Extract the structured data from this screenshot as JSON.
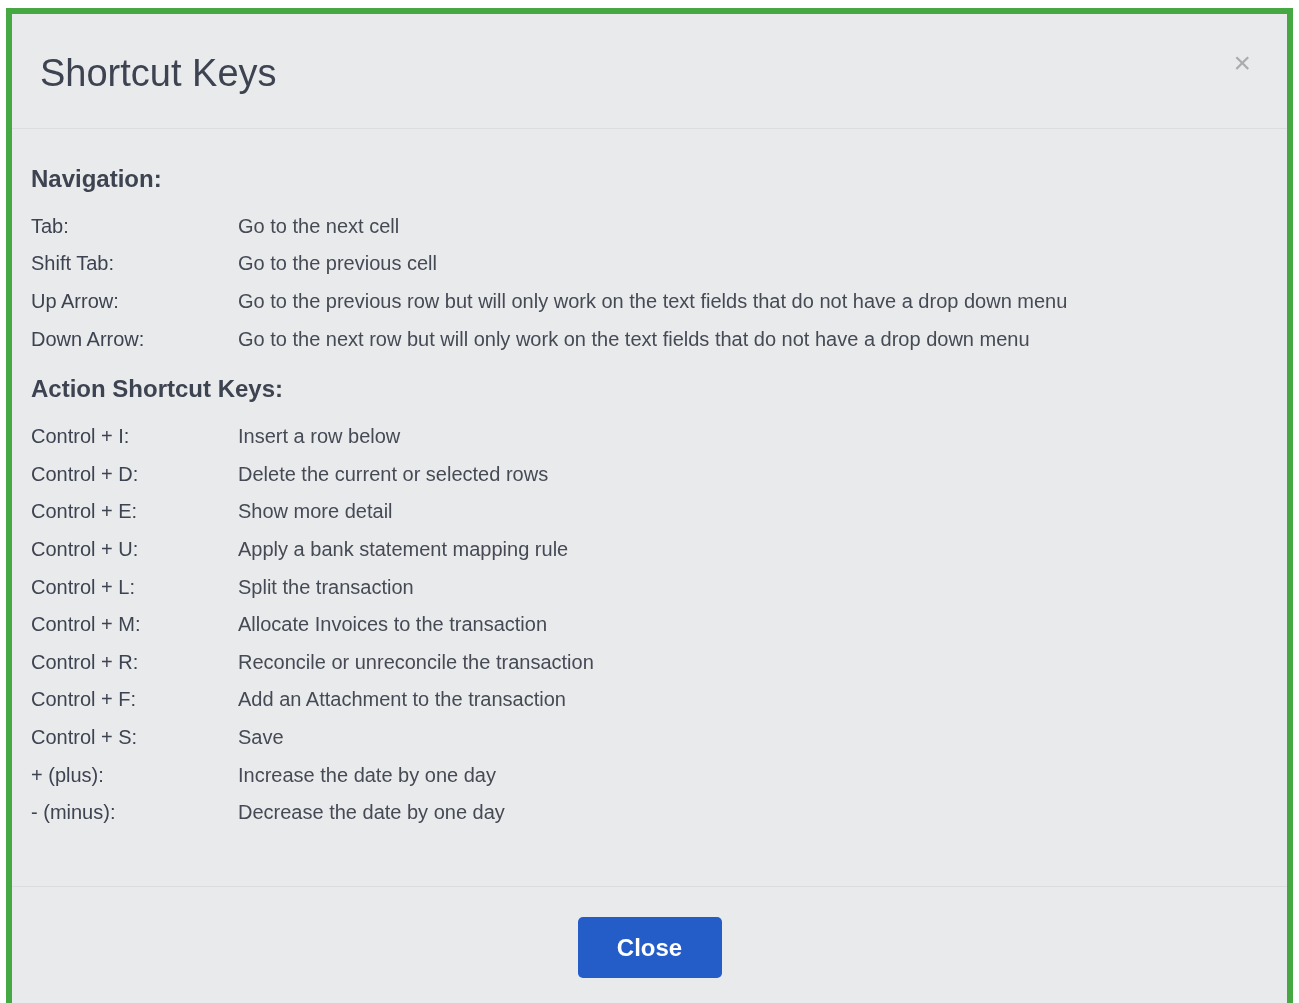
{
  "dialog": {
    "title": "Shortcut Keys",
    "close_icon": "×"
  },
  "sections": [
    {
      "heading": "Navigation:",
      "rows": [
        {
          "key": "Tab:",
          "action": "Go to the next cell"
        },
        {
          "key": "Shift Tab:",
          "action": "Go to the previous cell"
        },
        {
          "key": "Up Arrow:",
          "action": "Go to the previous row but will only work on the text fields that do not have a drop down menu"
        },
        {
          "key": "Down Arrow:",
          "action": "Go to the next row but will only work on the text fields that do not have a drop down menu"
        }
      ]
    },
    {
      "heading": "Action Shortcut Keys:",
      "rows": [
        {
          "key": "Control + I:",
          "action": "Insert a row below"
        },
        {
          "key": "Control + D:",
          "action": "Delete the current or selected rows"
        },
        {
          "key": "Control + E:",
          "action": "Show more detail"
        },
        {
          "key": "Control + U:",
          "action": "Apply a bank statement mapping rule"
        },
        {
          "key": "Control + L:",
          "action": "Split the transaction"
        },
        {
          "key": "Control + M:",
          "action": "Allocate Invoices to the transaction"
        },
        {
          "key": "Control + R:",
          "action": "Reconcile or unreconcile the transaction"
        },
        {
          "key": "Control + F:",
          "action": "Add an Attachment to the transaction"
        },
        {
          "key": "Control + S:",
          "action": "Save"
        },
        {
          "key": "+ (plus):",
          "action": "Increase the date by one day"
        },
        {
          "key": "- (minus):",
          "action": "Decrease the date by one day"
        }
      ]
    }
  ],
  "footer": {
    "button": "Close"
  }
}
